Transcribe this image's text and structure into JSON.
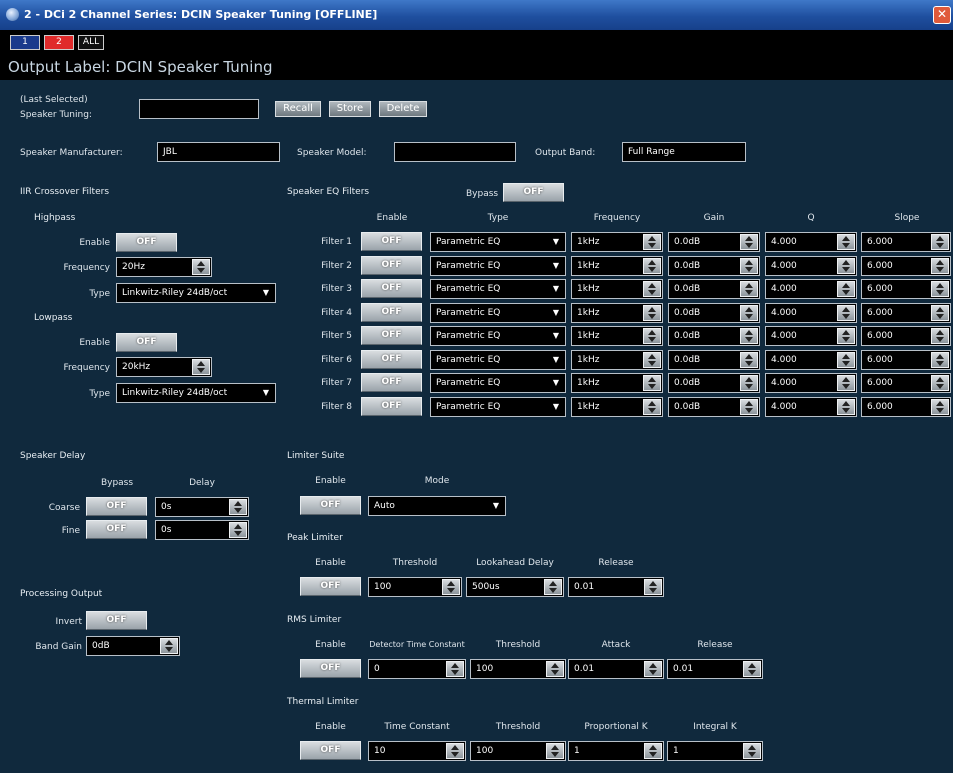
{
  "window": {
    "title": "2 - DCi 2 Channel Series: DCIN Speaker Tuning [OFFLINE]",
    "close_glyph": "✕"
  },
  "channels": [
    "1",
    "2",
    "ALL"
  ],
  "output_label": "Output Label: DCIN Speaker Tuning",
  "tuning": {
    "last_selected_label": "(Last Selected)",
    "speaker_tuning_label": "Speaker Tuning:",
    "value": "",
    "recall": "Recall",
    "store": "Store",
    "delete": "Delete"
  },
  "speaker_info": {
    "manufacturer_label": "Speaker Manufacturer:",
    "manufacturer": "JBL",
    "model_label": "Speaker Model:",
    "model": "",
    "band_label": "Output Band:",
    "band": "Full Range"
  },
  "iir": {
    "title": "IIR Crossover Filters",
    "highpass": {
      "title": "Highpass",
      "enable_label": "Enable",
      "enable": "OFF",
      "freq_label": "Frequency",
      "freq": "20Hz",
      "type_label": "Type",
      "type": "Linkwitz-Riley 24dB/oct"
    },
    "lowpass": {
      "title": "Lowpass",
      "enable_label": "Enable",
      "enable": "OFF",
      "freq_label": "Frequency",
      "freq": "20kHz",
      "type_label": "Type",
      "type": "Linkwitz-Riley 24dB/oct"
    }
  },
  "eq": {
    "title": "Speaker EQ Filters",
    "bypass_label": "Bypass",
    "bypass": "OFF",
    "headers": [
      "Enable",
      "Type",
      "Frequency",
      "Gain",
      "Q",
      "Slope"
    ],
    "filters": [
      {
        "name": "Filter 1",
        "enable": "OFF",
        "type": "Parametric EQ",
        "freq": "1kHz",
        "gain": "0.0dB",
        "q": "4.000",
        "slope": "6.000"
      },
      {
        "name": "Filter 2",
        "enable": "OFF",
        "type": "Parametric EQ",
        "freq": "1kHz",
        "gain": "0.0dB",
        "q": "4.000",
        "slope": "6.000"
      },
      {
        "name": "Filter 3",
        "enable": "OFF",
        "type": "Parametric EQ",
        "freq": "1kHz",
        "gain": "0.0dB",
        "q": "4.000",
        "slope": "6.000"
      },
      {
        "name": "Filter 4",
        "enable": "OFF",
        "type": "Parametric EQ",
        "freq": "1kHz",
        "gain": "0.0dB",
        "q": "4.000",
        "slope": "6.000"
      },
      {
        "name": "Filter 5",
        "enable": "OFF",
        "type": "Parametric EQ",
        "freq": "1kHz",
        "gain": "0.0dB",
        "q": "4.000",
        "slope": "6.000"
      },
      {
        "name": "Filter 6",
        "enable": "OFF",
        "type": "Parametric EQ",
        "freq": "1kHz",
        "gain": "0.0dB",
        "q": "4.000",
        "slope": "6.000"
      },
      {
        "name": "Filter 7",
        "enable": "OFF",
        "type": "Parametric EQ",
        "freq": "1kHz",
        "gain": "0.0dB",
        "q": "4.000",
        "slope": "6.000"
      },
      {
        "name": "Filter 8",
        "enable": "OFF",
        "type": "Parametric EQ",
        "freq": "1kHz",
        "gain": "0.0dB",
        "q": "4.000",
        "slope": "6.000"
      }
    ]
  },
  "delay": {
    "title": "Speaker Delay",
    "bypass_label": "Bypass",
    "delay_label": "Delay",
    "coarse_label": "Coarse",
    "coarse_bypass": "OFF",
    "coarse_value": "0s",
    "fine_label": "Fine",
    "fine_bypass": "OFF",
    "fine_value": "0s"
  },
  "processing": {
    "title": "Processing Output",
    "invert_label": "Invert",
    "invert": "OFF",
    "band_gain_label": "Band Gain",
    "band_gain": "0dB"
  },
  "limiter": {
    "title": "Limiter Suite",
    "enable_label": "Enable",
    "mode_label": "Mode",
    "enable": "OFF",
    "mode": "Auto",
    "peak": {
      "title": "Peak Limiter",
      "enable_label": "Enable",
      "threshold_label": "Threshold",
      "lookahead_label": "Lookahead Delay",
      "release_label": "Release",
      "enable": "OFF",
      "threshold": "100",
      "lookahead": "500us",
      "release": "0.01"
    },
    "rms": {
      "title": "RMS Limiter",
      "enable_label": "Enable",
      "dtc_label": "Detector Time Constant",
      "threshold_label": "Threshold",
      "attack_label": "Attack",
      "release_label": "Release",
      "enable": "OFF",
      "dtc": "0",
      "threshold": "100",
      "attack": "0.01",
      "release": "0.01"
    },
    "thermal": {
      "title": "Thermal Limiter",
      "enable_label": "Enable",
      "tc_label": "Time Constant",
      "threshold_label": "Threshold",
      "pk_label": "Proportional K",
      "ik_label": "Integral K",
      "enable": "OFF",
      "tc": "10",
      "threshold": "100",
      "pk": "1",
      "ik": "1"
    }
  },
  "colors": {
    "background": "#10293d",
    "titlebar": "#2458a8",
    "channel_1": "#1a3a8c",
    "channel_2": "#e02a2a",
    "channel_all": "#111111"
  }
}
